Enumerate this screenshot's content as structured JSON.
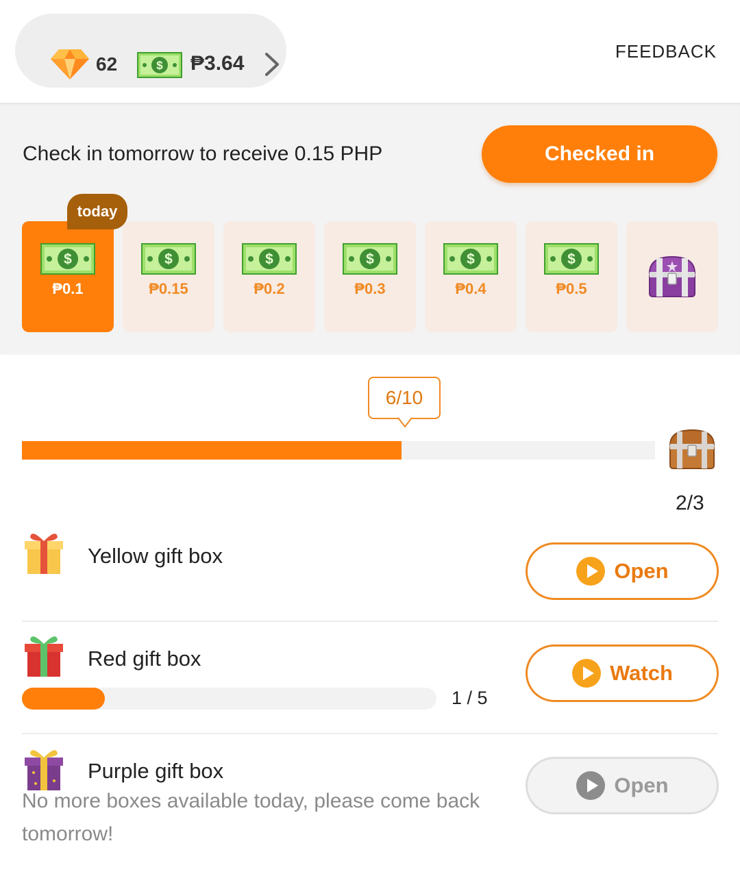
{
  "header": {
    "gems": "62",
    "cash": "₱3.64",
    "feedback_label": "FEEDBACK"
  },
  "checkin": {
    "message": "Check in tomorrow to receive 0.15 PHP",
    "button_label": "Checked in",
    "today_label": "today",
    "days": [
      {
        "amount": "₱0.1",
        "state": "today"
      },
      {
        "amount": "₱0.15",
        "state": "upcoming"
      },
      {
        "amount": "₱0.2",
        "state": "upcoming"
      },
      {
        "amount": "₱0.3",
        "state": "upcoming"
      },
      {
        "amount": "₱0.4",
        "state": "upcoming"
      },
      {
        "amount": "₱0.5",
        "state": "upcoming"
      },
      {
        "amount": "",
        "state": "chest"
      }
    ]
  },
  "progress": {
    "label": "6/10",
    "current": 6,
    "total": 10,
    "chest_count": "2/3"
  },
  "gifts": [
    {
      "name": "Yellow gift box",
      "button": "Open",
      "enabled": true,
      "color": "#f5b93c"
    },
    {
      "name": "Red gift box",
      "button": "Watch",
      "enabled": true,
      "color": "#d8332f",
      "progress_label": "1 / 5",
      "progress_fraction": 0.2
    },
    {
      "name": "Purple gift box",
      "button": "Open",
      "enabled": false,
      "color": "#7a3d8c",
      "note": "No more boxes available today, please come back tomorrow!"
    }
  ],
  "colors": {
    "accent": "#ff7f0a",
    "tag_brown": "#a65f0a",
    "day_bg": "#f8ebe3"
  }
}
